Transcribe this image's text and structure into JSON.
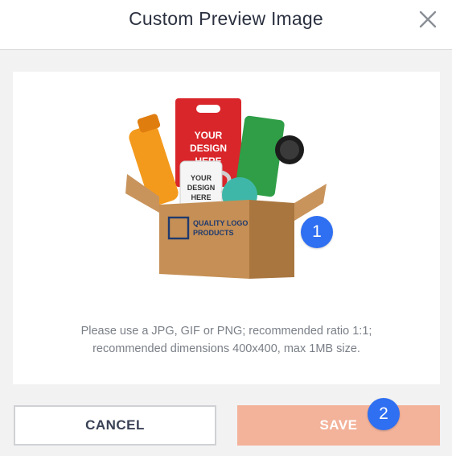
{
  "dialog": {
    "title": "Custom Preview Image",
    "close_icon": "close-icon"
  },
  "preview": {
    "image_label": "product-box-preview",
    "mug_text": "YOUR DESIGN HERE",
    "box_brand": "QUALITY LOGO PRODUCTS",
    "help_line1": "Please use a JPG, GIF or PNG; recommended ratio 1:1;",
    "help_line2": "recommended dimensions 400x400, max 1MB size."
  },
  "buttons": {
    "cancel_label": "CANCEL",
    "save_label": "SAVE"
  },
  "badges": {
    "image_badge": "1",
    "save_badge": "2"
  },
  "colors": {
    "save_bg": "#f3b29a",
    "badge_bg": "#2f6ff1",
    "title_text": "#2b3140"
  }
}
